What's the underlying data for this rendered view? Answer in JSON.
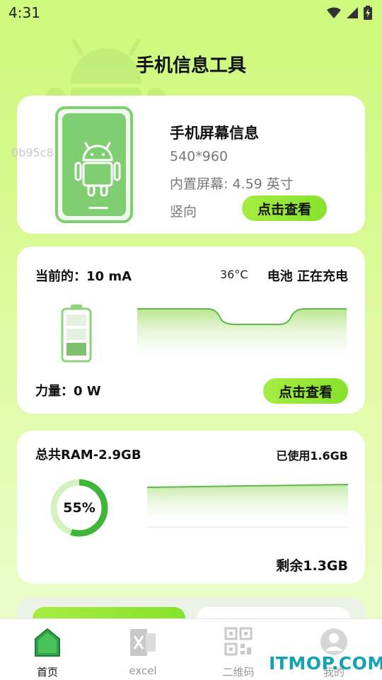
{
  "status_bar": {
    "time": "4:31"
  },
  "app": {
    "title": "手机信息工具"
  },
  "overlay_id": "0b95c8",
  "screen_card": {
    "title": "手机屏幕信息",
    "resolution": "540*960",
    "screen_info": "内置屏幕: 4.59 英寸",
    "orientation": "竖向",
    "button": "点击查看"
  },
  "battery_card": {
    "current": "当前的：10 mA",
    "temperature": "36°C",
    "status": "电池 正在充电",
    "power": "力量：0 W",
    "button": "点击查看"
  },
  "ram_card": {
    "total": "总共RAM-2.9GB",
    "used": "已使用1.6GB",
    "percent_label": "55%",
    "percent": 55,
    "remaining": "剩余1.3GB"
  },
  "bottom_nav": {
    "items": [
      {
        "label": "首页",
        "icon": "home-icon"
      },
      {
        "label": "excel",
        "icon": "excel-icon"
      },
      {
        "label": "二维码",
        "icon": "qrcode-icon"
      },
      {
        "label": "我的",
        "icon": "profile-icon"
      }
    ]
  },
  "watermark": "ITMOP.COM",
  "colors": {
    "accent": "#8fe436",
    "accent_dark": "#3fb53a",
    "phone_green": "#7fcf72"
  }
}
